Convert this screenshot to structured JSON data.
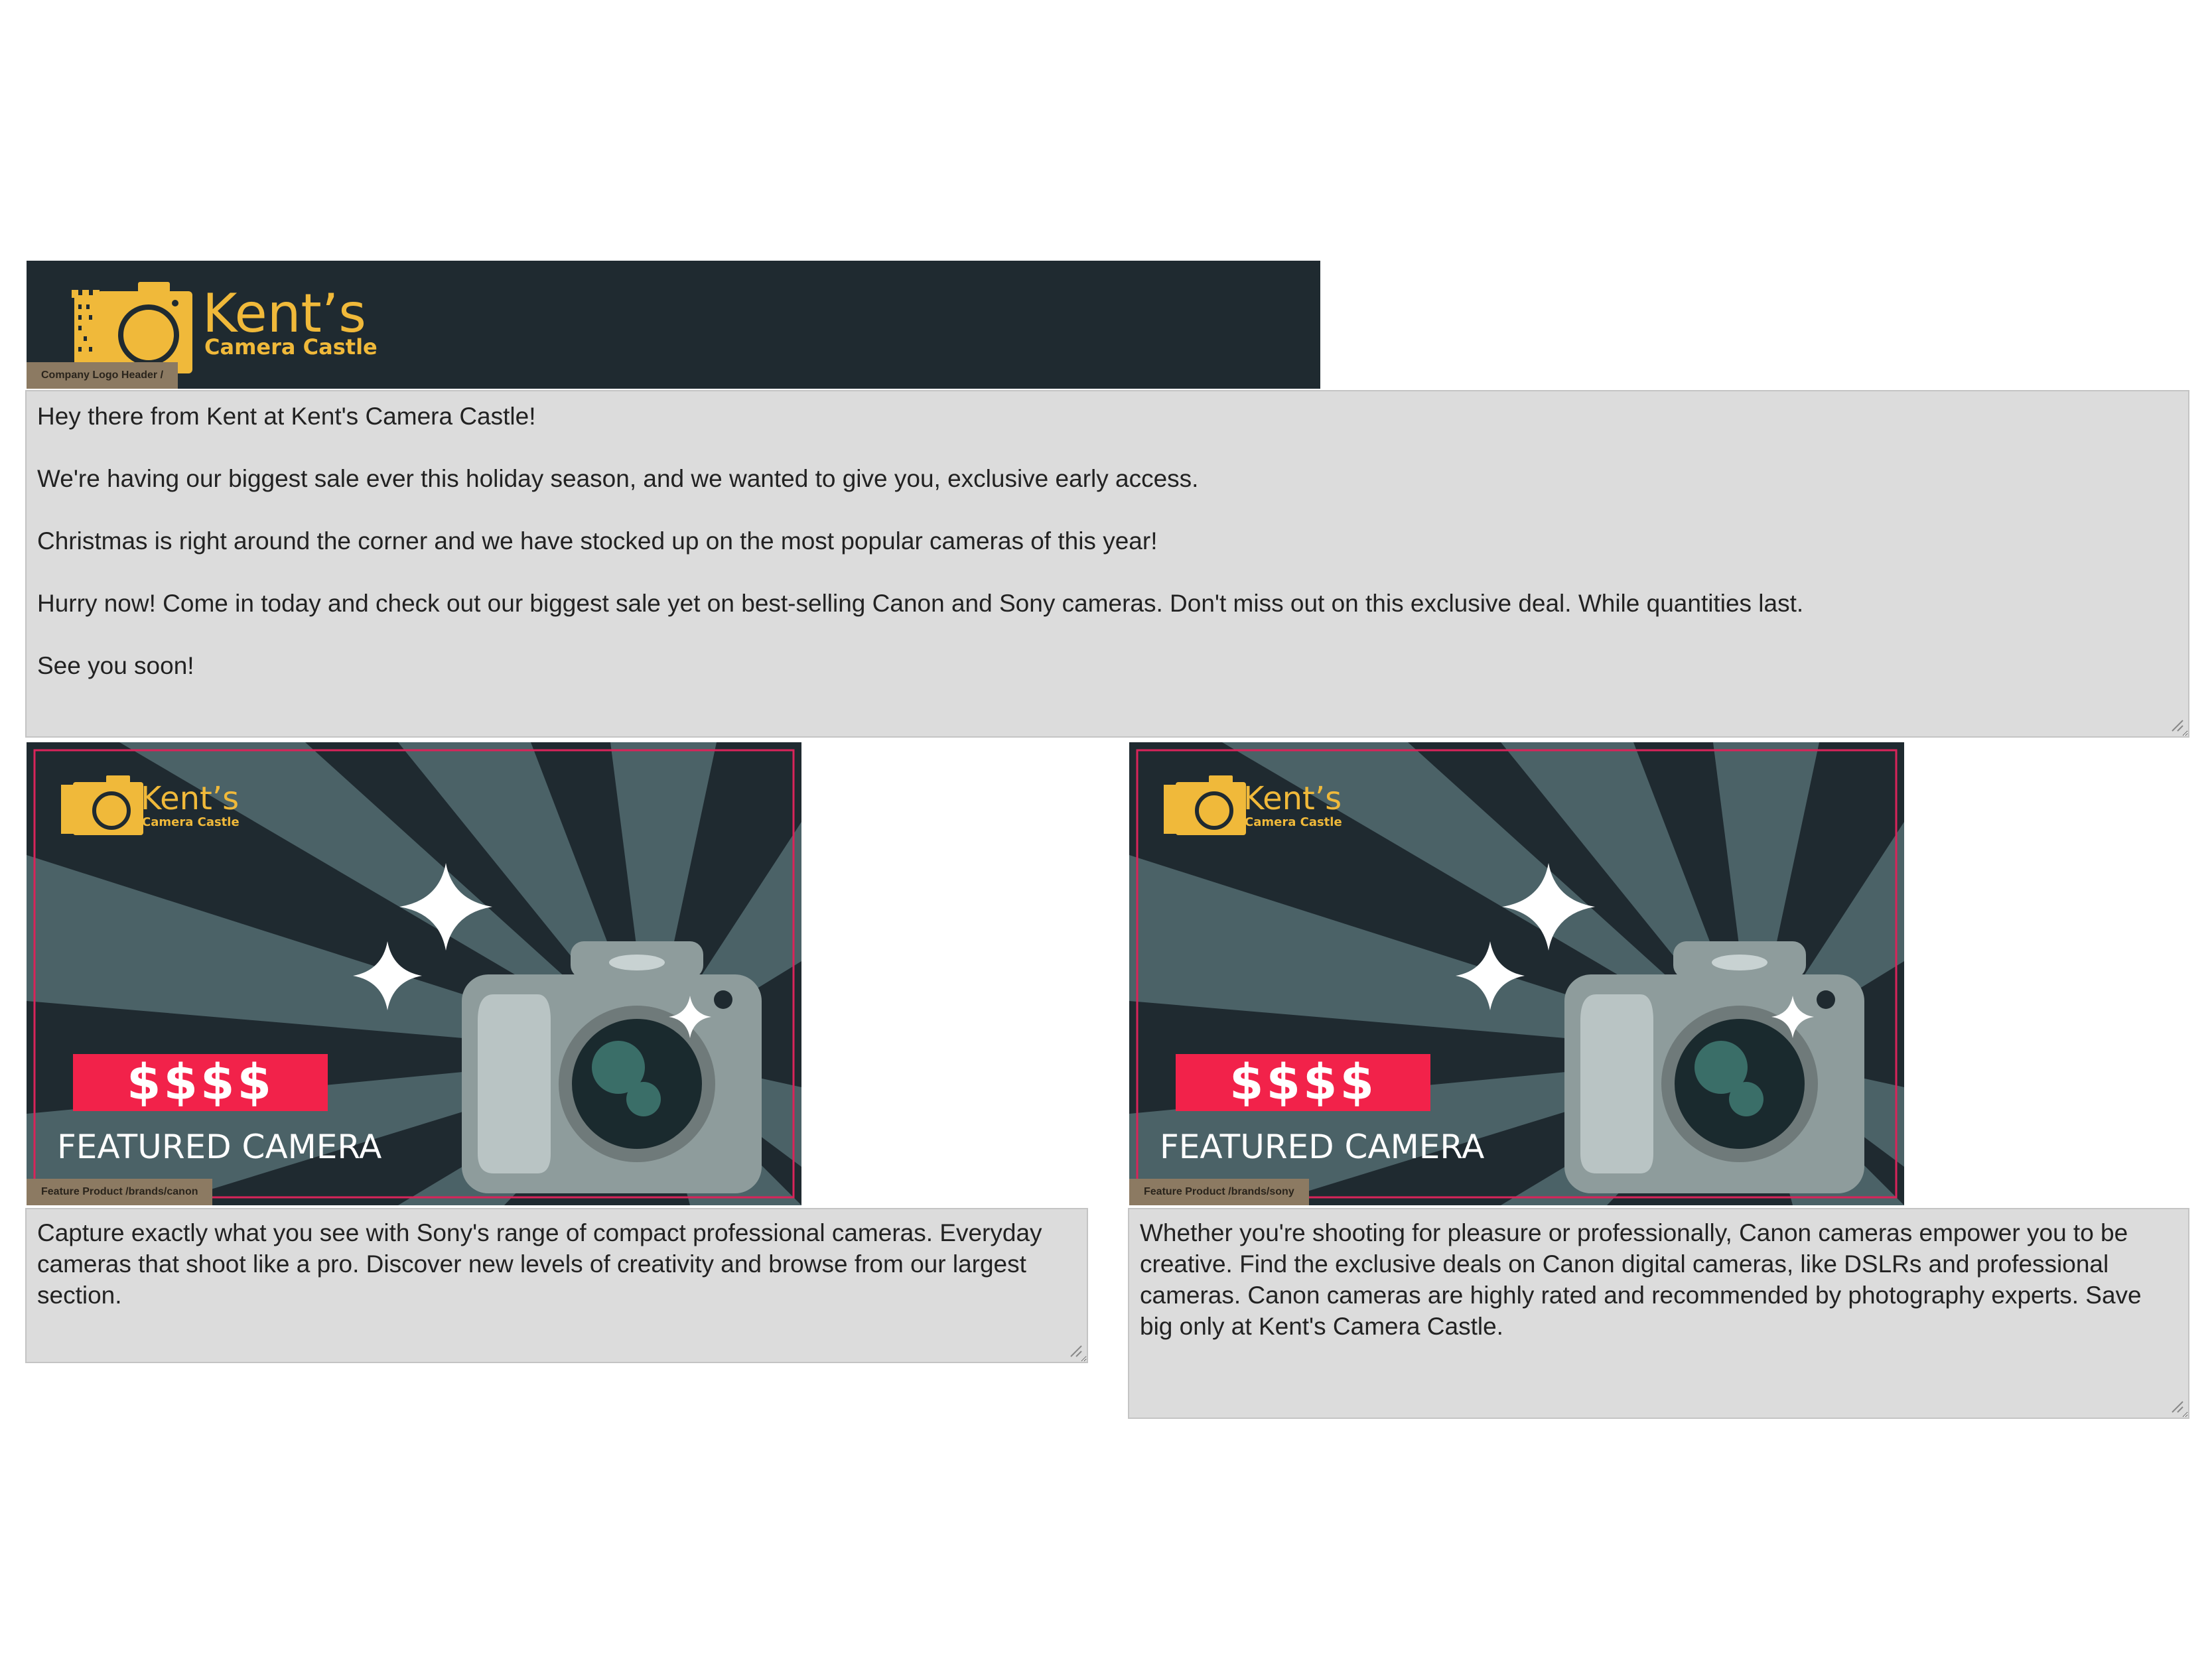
{
  "header": {
    "logo_name": "Kent’s",
    "logo_sub": "Camera Castle",
    "tag": "Company Logo Header /"
  },
  "intro": {
    "paragraphs": [
      "Hey there from Kent at Kent's Camera Castle!",
      "We're having our biggest sale ever this holiday season, and we wanted to give you, exclusive early access.",
      "Christmas is right around the corner and we have stocked up on the most popular cameras of this year!",
      "Hurry now! Come in today and check out our biggest sale yet on best-selling Canon and Sony cameras. Don't miss out on this exclusive deal. While quantities last.",
      "See you soon!"
    ]
  },
  "products": [
    {
      "banner": {
        "logo_name": "Kent’s",
        "logo_sub": "Camera Castle",
        "price": "$$$$",
        "featured": "FEATURED CAMERA",
        "tag": "Feature Product /brands/canon"
      },
      "description": "Capture exactly what you see with Sony's range of compact professional cameras. Everyday cameras that shoot like a pro. Discover new levels of creativity and browse from our largest section."
    },
    {
      "banner": {
        "logo_name": "Kent’s",
        "logo_sub": "Camera Castle",
        "price": "$$$$",
        "featured": "FEATURED CAMERA",
        "tag": "Feature Product /brands/sony"
      },
      "description": "Whether you're shooting for pleasure or professionally, Canon cameras empower you to be creative. Find the exclusive deals on Canon digital cameras, like DSLRs and professional cameras. Canon cameras are highly rated and recommended by photography experts. Save big only at Kent's Camera Castle."
    }
  ],
  "colors": {
    "header_bg": "#1f2a30",
    "logo_yellow": "#f0b93a",
    "price_red": "#f2224a",
    "ray_light": "#4b6267",
    "textarea_bg": "#dcdcdc",
    "tag_bg": "#8c7a62"
  }
}
